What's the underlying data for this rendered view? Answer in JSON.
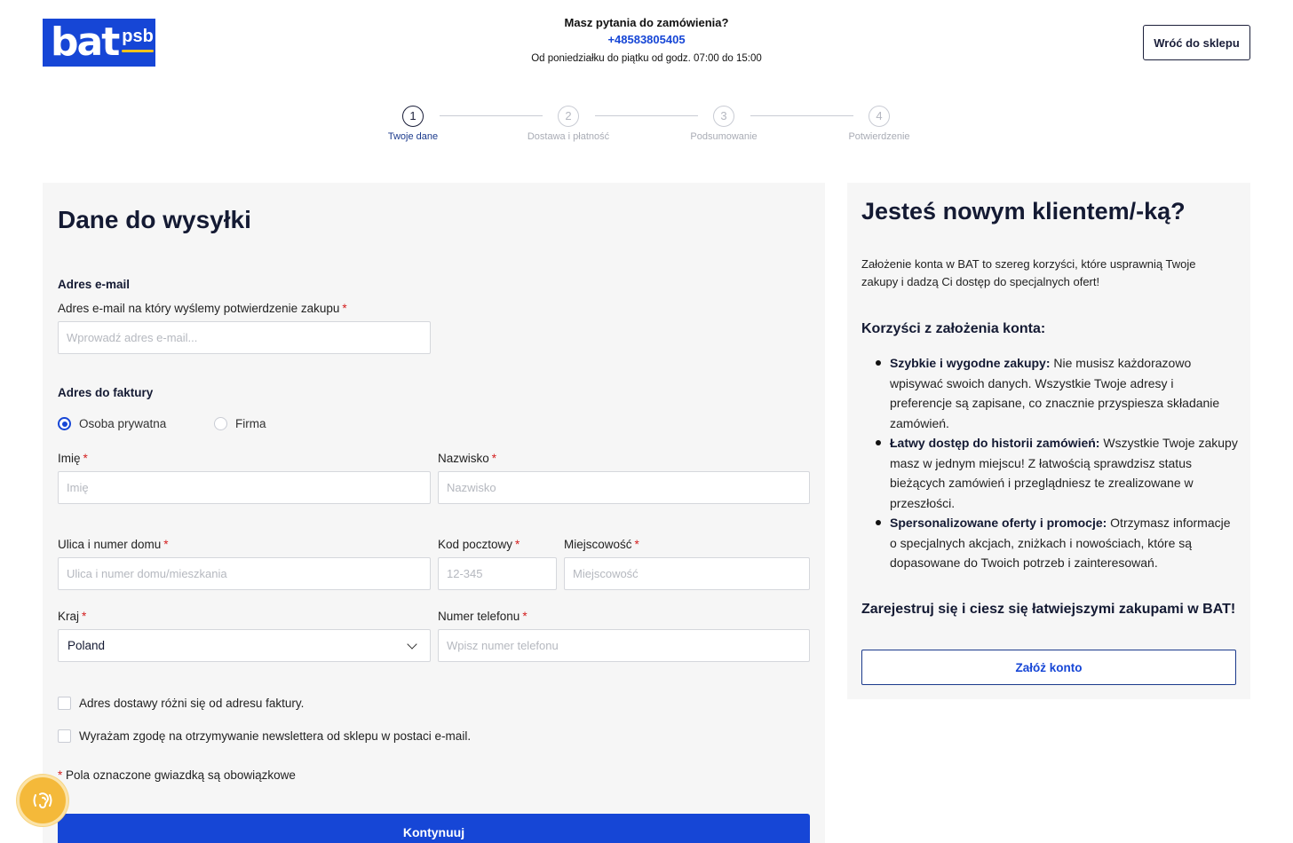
{
  "logo": {
    "main": "bat",
    "sub": "psb"
  },
  "contact": {
    "question": "Masz pytania do zamówienia?",
    "phone": "+48583805405",
    "hours": "Od poniedziałku do piątku od godz. 07:00 do 15:00"
  },
  "header": {
    "back_label": "Wróć do sklepu"
  },
  "steps": [
    {
      "num": "1",
      "label": "Twoje dane",
      "active": true
    },
    {
      "num": "2",
      "label": "Dostawa i płatność",
      "active": false
    },
    {
      "num": "3",
      "label": "Podsumowanie",
      "active": false
    },
    {
      "num": "4",
      "label": "Potwierdzenie",
      "active": false
    }
  ],
  "form": {
    "title": "Dane do wysyłki",
    "email_section": "Adres e-mail",
    "email_label": "Adres e-mail na który wyślemy potwierdzenie zakupu",
    "email_placeholder": "Wprowadź adres e-mail...",
    "invoice_section": "Adres do faktury",
    "radio_private": "Osoba prywatna",
    "radio_company": "Firma",
    "first_name_label": "Imię",
    "first_name_placeholder": "Imię",
    "last_name_label": "Nazwisko",
    "last_name_placeholder": "Nazwisko",
    "street_label": "Ulica i numer domu",
    "street_placeholder": "Ulica i numer domu/mieszkania",
    "postal_label": "Kod pocztowy",
    "postal_placeholder": "12-345",
    "city_label": "Miejscowość",
    "city_placeholder": "Miejscowość",
    "country_label": "Kraj",
    "country_value": "Poland",
    "phone_label": "Numer telefonu",
    "phone_placeholder": "Wpisz numer telefonu",
    "check_delivery": "Adres dostawy różni się od adresu faktury.",
    "check_newsletter": "Wyrażam zgodę na otrzymywanie newslettera od sklepu w postaci e-mail.",
    "required_star": "*",
    "required_note": "Pola oznaczone gwiazdką są obowiązkowe",
    "continue_label": "Kontynuuj"
  },
  "side": {
    "title": "Jesteś nowym klientem/-ką?",
    "intro": "Założenie konta w BAT to szereg korzyści, które usprawnią Twoje zakupy i dadzą Ci dostęp do specjalnych ofert!",
    "benefits_title": "Korzyści z założenia konta:",
    "benefits": [
      {
        "bold": "Szybkie i wygodne zakupy:",
        "text": " Nie musisz każdorazowo wpisywać swoich danych. Wszystkie Twoje adresy i preferencje są zapisane, co znacznie przyspiesza składanie zamówień."
      },
      {
        "bold": "Łatwy dostęp do historii zamówień:",
        "text": " Wszystkie Twoje zakupy masz w jednym miejscu! Z łatwością sprawdzisz status bieżących zamówień i przeglądniesz te zrealizowane w przeszłości."
      },
      {
        "bold": "Spersonalizowane oferty i promocje:",
        "text": " Otrzymasz informacje o specjalnych akcjach, zniżkach i nowościach, które są dopasowane do Twoich potrzeb i zainteresowań."
      }
    ],
    "cta": "Zarejestruj się i ciesz się łatwiejszymi zakupami w BAT!",
    "create_label": "Załóż konto"
  },
  "colors": {
    "brand": "#1646d6",
    "accent_yellow": "#f4c21b",
    "panel_bg": "#f6f6f6",
    "required": "#d42020"
  },
  "icons": {
    "accessibility": "accessibility-icon"
  }
}
